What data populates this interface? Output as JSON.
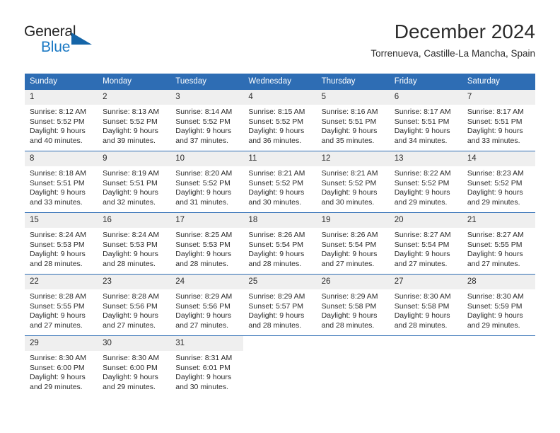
{
  "brand": {
    "logo_primary": "General",
    "logo_secondary": "Blue",
    "triangle_icon": "triangle-icon",
    "accent_color": "#2e6db4"
  },
  "header": {
    "title": "December 2024",
    "subtitle": "Torrenueva, Castille-La Mancha, Spain"
  },
  "calendar": {
    "weekday_headers": [
      "Sunday",
      "Monday",
      "Tuesday",
      "Wednesday",
      "Thursday",
      "Friday",
      "Saturday"
    ],
    "header_bg": "#2e6db4",
    "daynum_bg": "#efefef",
    "weeks": [
      [
        {
          "day": "1",
          "sunrise": "Sunrise: 8:12 AM",
          "sunset": "Sunset: 5:52 PM",
          "daylight": "Daylight: 9 hours and 40 minutes."
        },
        {
          "day": "2",
          "sunrise": "Sunrise: 8:13 AM",
          "sunset": "Sunset: 5:52 PM",
          "daylight": "Daylight: 9 hours and 39 minutes."
        },
        {
          "day": "3",
          "sunrise": "Sunrise: 8:14 AM",
          "sunset": "Sunset: 5:52 PM",
          "daylight": "Daylight: 9 hours and 37 minutes."
        },
        {
          "day": "4",
          "sunrise": "Sunrise: 8:15 AM",
          "sunset": "Sunset: 5:52 PM",
          "daylight": "Daylight: 9 hours and 36 minutes."
        },
        {
          "day": "5",
          "sunrise": "Sunrise: 8:16 AM",
          "sunset": "Sunset: 5:51 PM",
          "daylight": "Daylight: 9 hours and 35 minutes."
        },
        {
          "day": "6",
          "sunrise": "Sunrise: 8:17 AM",
          "sunset": "Sunset: 5:51 PM",
          "daylight": "Daylight: 9 hours and 34 minutes."
        },
        {
          "day": "7",
          "sunrise": "Sunrise: 8:17 AM",
          "sunset": "Sunset: 5:51 PM",
          "daylight": "Daylight: 9 hours and 33 minutes."
        }
      ],
      [
        {
          "day": "8",
          "sunrise": "Sunrise: 8:18 AM",
          "sunset": "Sunset: 5:51 PM",
          "daylight": "Daylight: 9 hours and 33 minutes."
        },
        {
          "day": "9",
          "sunrise": "Sunrise: 8:19 AM",
          "sunset": "Sunset: 5:51 PM",
          "daylight": "Daylight: 9 hours and 32 minutes."
        },
        {
          "day": "10",
          "sunrise": "Sunrise: 8:20 AM",
          "sunset": "Sunset: 5:52 PM",
          "daylight": "Daylight: 9 hours and 31 minutes."
        },
        {
          "day": "11",
          "sunrise": "Sunrise: 8:21 AM",
          "sunset": "Sunset: 5:52 PM",
          "daylight": "Daylight: 9 hours and 30 minutes."
        },
        {
          "day": "12",
          "sunrise": "Sunrise: 8:21 AM",
          "sunset": "Sunset: 5:52 PM",
          "daylight": "Daylight: 9 hours and 30 minutes."
        },
        {
          "day": "13",
          "sunrise": "Sunrise: 8:22 AM",
          "sunset": "Sunset: 5:52 PM",
          "daylight": "Daylight: 9 hours and 29 minutes."
        },
        {
          "day": "14",
          "sunrise": "Sunrise: 8:23 AM",
          "sunset": "Sunset: 5:52 PM",
          "daylight": "Daylight: 9 hours and 29 minutes."
        }
      ],
      [
        {
          "day": "15",
          "sunrise": "Sunrise: 8:24 AM",
          "sunset": "Sunset: 5:53 PM",
          "daylight": "Daylight: 9 hours and 28 minutes."
        },
        {
          "day": "16",
          "sunrise": "Sunrise: 8:24 AM",
          "sunset": "Sunset: 5:53 PM",
          "daylight": "Daylight: 9 hours and 28 minutes."
        },
        {
          "day": "17",
          "sunrise": "Sunrise: 8:25 AM",
          "sunset": "Sunset: 5:53 PM",
          "daylight": "Daylight: 9 hours and 28 minutes."
        },
        {
          "day": "18",
          "sunrise": "Sunrise: 8:26 AM",
          "sunset": "Sunset: 5:54 PM",
          "daylight": "Daylight: 9 hours and 28 minutes."
        },
        {
          "day": "19",
          "sunrise": "Sunrise: 8:26 AM",
          "sunset": "Sunset: 5:54 PM",
          "daylight": "Daylight: 9 hours and 27 minutes."
        },
        {
          "day": "20",
          "sunrise": "Sunrise: 8:27 AM",
          "sunset": "Sunset: 5:54 PM",
          "daylight": "Daylight: 9 hours and 27 minutes."
        },
        {
          "day": "21",
          "sunrise": "Sunrise: 8:27 AM",
          "sunset": "Sunset: 5:55 PM",
          "daylight": "Daylight: 9 hours and 27 minutes."
        }
      ],
      [
        {
          "day": "22",
          "sunrise": "Sunrise: 8:28 AM",
          "sunset": "Sunset: 5:55 PM",
          "daylight": "Daylight: 9 hours and 27 minutes."
        },
        {
          "day": "23",
          "sunrise": "Sunrise: 8:28 AM",
          "sunset": "Sunset: 5:56 PM",
          "daylight": "Daylight: 9 hours and 27 minutes."
        },
        {
          "day": "24",
          "sunrise": "Sunrise: 8:29 AM",
          "sunset": "Sunset: 5:56 PM",
          "daylight": "Daylight: 9 hours and 27 minutes."
        },
        {
          "day": "25",
          "sunrise": "Sunrise: 8:29 AM",
          "sunset": "Sunset: 5:57 PM",
          "daylight": "Daylight: 9 hours and 28 minutes."
        },
        {
          "day": "26",
          "sunrise": "Sunrise: 8:29 AM",
          "sunset": "Sunset: 5:58 PM",
          "daylight": "Daylight: 9 hours and 28 minutes."
        },
        {
          "day": "27",
          "sunrise": "Sunrise: 8:30 AM",
          "sunset": "Sunset: 5:58 PM",
          "daylight": "Daylight: 9 hours and 28 minutes."
        },
        {
          "day": "28",
          "sunrise": "Sunrise: 8:30 AM",
          "sunset": "Sunset: 5:59 PM",
          "daylight": "Daylight: 9 hours and 29 minutes."
        }
      ],
      [
        {
          "day": "29",
          "sunrise": "Sunrise: 8:30 AM",
          "sunset": "Sunset: 6:00 PM",
          "daylight": "Daylight: 9 hours and 29 minutes."
        },
        {
          "day": "30",
          "sunrise": "Sunrise: 8:30 AM",
          "sunset": "Sunset: 6:00 PM",
          "daylight": "Daylight: 9 hours and 29 minutes."
        },
        {
          "day": "31",
          "sunrise": "Sunrise: 8:31 AM",
          "sunset": "Sunset: 6:01 PM",
          "daylight": "Daylight: 9 hours and 30 minutes."
        },
        {
          "day": "",
          "sunrise": "",
          "sunset": "",
          "daylight": ""
        },
        {
          "day": "",
          "sunrise": "",
          "sunset": "",
          "daylight": ""
        },
        {
          "day": "",
          "sunrise": "",
          "sunset": "",
          "daylight": ""
        },
        {
          "day": "",
          "sunrise": "",
          "sunset": "",
          "daylight": ""
        }
      ]
    ]
  }
}
